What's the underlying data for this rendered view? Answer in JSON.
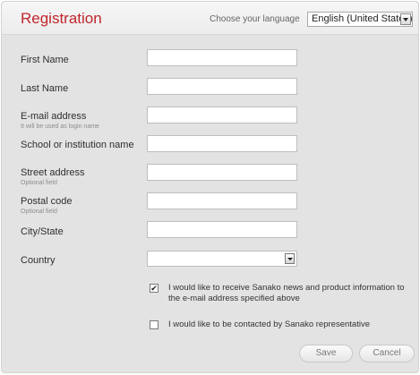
{
  "header": {
    "title": "Registration",
    "language_label": "Choose your language",
    "language_selected": "English (United States)"
  },
  "form": {
    "fields": [
      {
        "label": "First Name",
        "sub": "",
        "value": ""
      },
      {
        "label": "Last Name",
        "sub": "",
        "value": ""
      },
      {
        "label": "E-mail address",
        "sub": "It will be used as login name",
        "value": ""
      },
      {
        "label": "School or institution name",
        "sub": "",
        "value": ""
      },
      {
        "label": "Street address",
        "sub": "Optional field",
        "value": ""
      },
      {
        "label": "Postal code",
        "sub": "Optional field",
        "value": ""
      },
      {
        "label": "City/State",
        "sub": "",
        "value": ""
      }
    ],
    "country": {
      "label": "Country",
      "value": ""
    },
    "checkboxes": [
      {
        "text": "I would like to receive Sanako news and product information to the e-mail address specified above",
        "checked": true,
        "mark": "✔"
      },
      {
        "text": "I would like to be contacted by Sanako representative",
        "checked": false,
        "mark": ""
      }
    ]
  },
  "buttons": {
    "save": "Save",
    "cancel": "Cancel"
  }
}
